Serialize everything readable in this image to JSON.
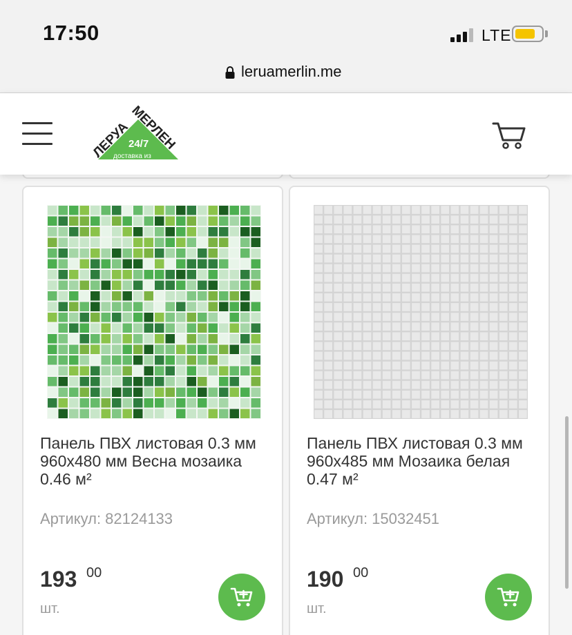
{
  "status": {
    "time": "17:50",
    "network": "LTE",
    "battery_color": "#f5c400"
  },
  "browser": {
    "url": "leruamerlin.me"
  },
  "header": {
    "logo": {
      "top_word": "МЕРЛЕН",
      "left_word": "ЛЕРУА",
      "badge": "24/7",
      "tagline": "доставка из"
    },
    "brand_color": "#5dbb4e"
  },
  "products": [
    {
      "title": "Панель ПВХ листовая 0.3 мм 960х480 мм Весна мозаика 0.46 м²",
      "sku_label": "Артикул:",
      "sku": "82124133",
      "price_main": "193",
      "price_cents": "00",
      "unit": "шт."
    },
    {
      "title": "Панель ПВХ листовая 0.3 мм 960х485 мм Мозаика белая 0.47 м²",
      "sku_label": "Артикул:",
      "sku": "15032451",
      "price_main": "190",
      "price_cents": "00",
      "unit": "шт."
    }
  ]
}
